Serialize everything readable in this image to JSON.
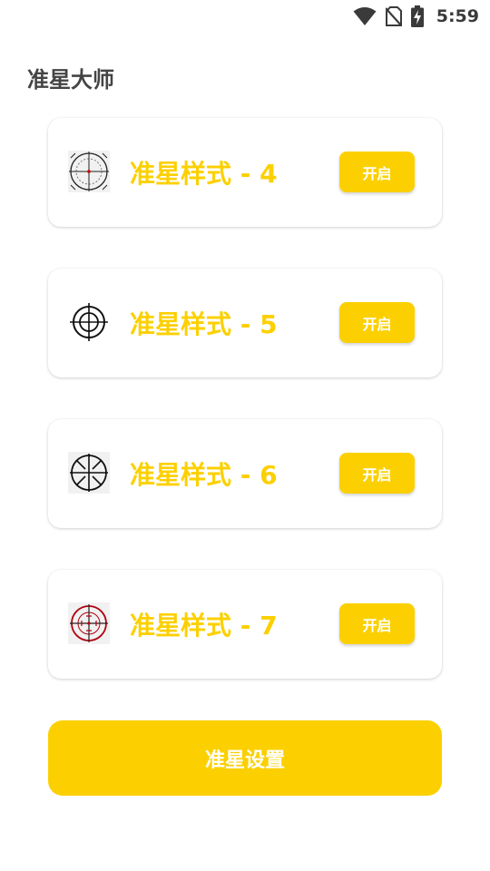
{
  "status_bar": {
    "time": "5:59",
    "icons": [
      "wifi-icon",
      "no-sim-icon",
      "battery-charging-icon"
    ]
  },
  "app": {
    "title": "准星大师"
  },
  "cards": [
    {
      "title": "准星样式 - 4",
      "button": "开启",
      "icon": "crosshair-style-4-icon"
    },
    {
      "title": "准星样式 - 5",
      "button": "开启",
      "icon": "crosshair-style-5-icon"
    },
    {
      "title": "准星样式 - 6",
      "button": "开启",
      "icon": "crosshair-style-6-icon"
    },
    {
      "title": "准星样式 - 7",
      "button": "开启",
      "icon": "crosshair-style-7-icon"
    }
  ],
  "settings_button": "准星设置",
  "colors": {
    "accent": "#fcd000",
    "title_text": "#444444",
    "button_text": "#ffffff"
  }
}
